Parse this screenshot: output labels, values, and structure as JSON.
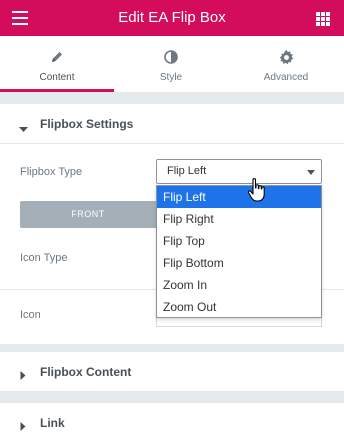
{
  "header": {
    "title": "Edit EA Flip Box",
    "menu_icon": "hamburger-icon",
    "grid_icon": "apps-grid-icon"
  },
  "tabs": [
    {
      "label": "Content",
      "icon": "pencil-icon",
      "active": true
    },
    {
      "label": "Style",
      "icon": "contrast-icon",
      "active": false
    },
    {
      "label": "Advanced",
      "icon": "gear-icon",
      "active": false
    }
  ],
  "sections": {
    "settings": {
      "title": "Flipbox Settings"
    },
    "content": {
      "title": "Flipbox Content"
    },
    "link": {
      "title": "Link"
    }
  },
  "controls": {
    "flipbox_type": {
      "label": "Flipbox Type",
      "value": "Flip Left"
    },
    "front_label": "FRONT",
    "icon_type": {
      "label": "Icon Type"
    },
    "icon": {
      "label": "Icon",
      "value": "snowflake-o"
    }
  },
  "dropdown": {
    "options": [
      "Flip Left",
      "Flip Right",
      "Flip Top",
      "Flip Bottom",
      "Zoom In",
      "Zoom Out"
    ],
    "selected": "Flip Left"
  },
  "colors": {
    "brand": "#d30c5c",
    "selected_option": "#1e73e8"
  }
}
